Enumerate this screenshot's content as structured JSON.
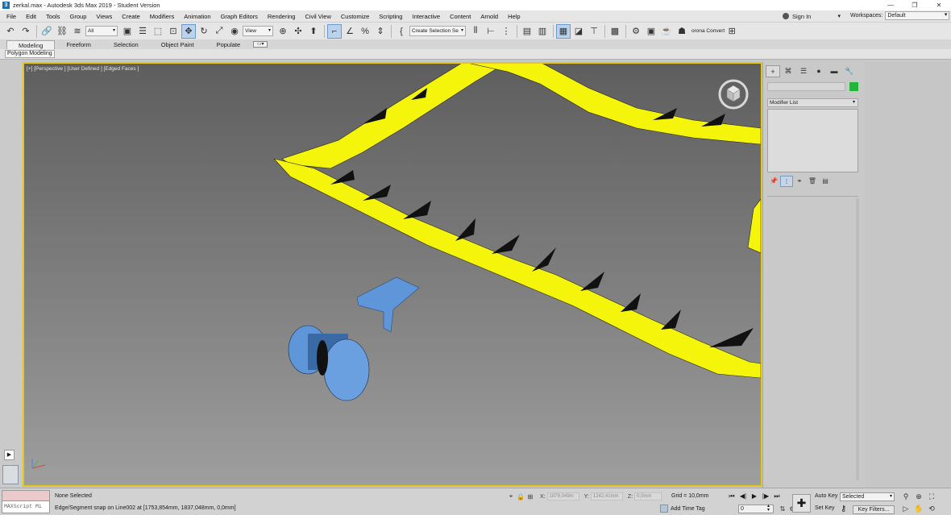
{
  "window": {
    "title": "zerkal.max - Autodesk 3ds Max 2019 - Student Version",
    "app_icon": "3ds-max-icon",
    "minimize": "—",
    "restore": "❐",
    "close": "✕"
  },
  "menu": {
    "items": [
      "File",
      "Edit",
      "Tools",
      "Group",
      "Views",
      "Create",
      "Modifiers",
      "Animation",
      "Graph Editors",
      "Rendering",
      "Civil View",
      "Customize",
      "Scripting",
      "Interactive",
      "Content",
      "Arnold",
      "Help"
    ],
    "sign_in": "Sign In",
    "workspaces_label": "Workspaces:",
    "workspaces_value": "Default"
  },
  "toolbar": {
    "selection_filter": "All",
    "ref_coord": "View",
    "named_selection": "Create Selection Se",
    "corona_label": "orona Convert"
  },
  "ribbon": {
    "tabs": [
      "Modeling",
      "Freeform",
      "Selection",
      "Object Paint",
      "Populate"
    ],
    "active_tab": "Modeling",
    "sub_label": "Polygon Modeling"
  },
  "viewport": {
    "label": "[+] [Perspective ] [User Defined ] [Edged Faces ]",
    "border_color": "#e3c81c",
    "ring_color": "#f5f50c",
    "object_color": "#5f95d9"
  },
  "command_panel": {
    "modifier_list": "Modifier List",
    "object_color": "#22b53a"
  },
  "status": {
    "maxscript_placeholder": "MAXScript Mi",
    "selection": "None Selected",
    "prompt": "Edge/Segment snap on Line002 at [1753,854mm, 1837,048mm, 0,0mm]",
    "x_label": "X:",
    "x_value": "1879,049m",
    "y_label": "Y:",
    "y_value": "1242,41mm",
    "z_label": "Z:",
    "z_value": "0,0mm",
    "grid": "Grid = 10,0mm",
    "add_time_tag": "Add Time Tag",
    "frame": "0",
    "auto_key": "Auto Key",
    "set_key": "Set Key",
    "selected": "Selected",
    "key_filters": "Key Filters..."
  }
}
